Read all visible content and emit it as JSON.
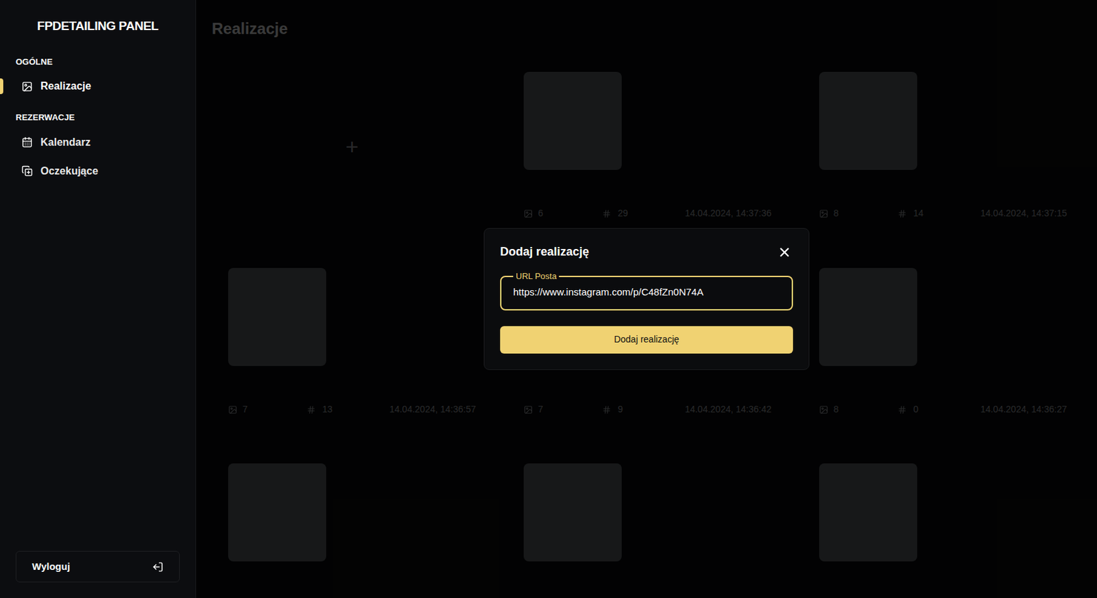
{
  "sidebar": {
    "title": "FPDETAILING PANEL",
    "sections": [
      {
        "label": "OGÓLNE",
        "items": [
          {
            "label": "Realizacje",
            "icon": "image",
            "selected": true
          }
        ]
      },
      {
        "label": "REZERWACJE",
        "items": [
          {
            "label": "Kalendarz",
            "icon": "calendar",
            "selected": false
          },
          {
            "label": "Oczekujące",
            "icon": "pending",
            "selected": false
          }
        ]
      }
    ],
    "logout": "Wyloguj"
  },
  "page": {
    "title": "Realizacje",
    "add_tile": "+"
  },
  "cards": [
    {
      "kind": "full",
      "images": "6",
      "number": "29",
      "date": "14.04.2024, 14:37:36"
    },
    {
      "kind": "full",
      "images": "8",
      "number": "14",
      "date": "14.04.2024, 14:37:15"
    },
    {
      "kind": "full",
      "images": "7",
      "number": "13",
      "date": "14.04.2024, 14:36:57"
    },
    {
      "kind": "full",
      "images": "7",
      "number": "9",
      "date": "14.04.2024, 14:36:42"
    },
    {
      "kind": "full",
      "images": "8",
      "number": "0",
      "date": "14.04.2024, 14:36:27"
    },
    {
      "kind": "image-only"
    },
    {
      "kind": "image-only"
    },
    {
      "kind": "image-only"
    }
  ],
  "modal": {
    "title": "Dodaj realizację",
    "field_label": "URL Posta",
    "field_value": "https://www.instagram.com/p/C48fZn0N74A",
    "button": "Dodaj realizację"
  }
}
